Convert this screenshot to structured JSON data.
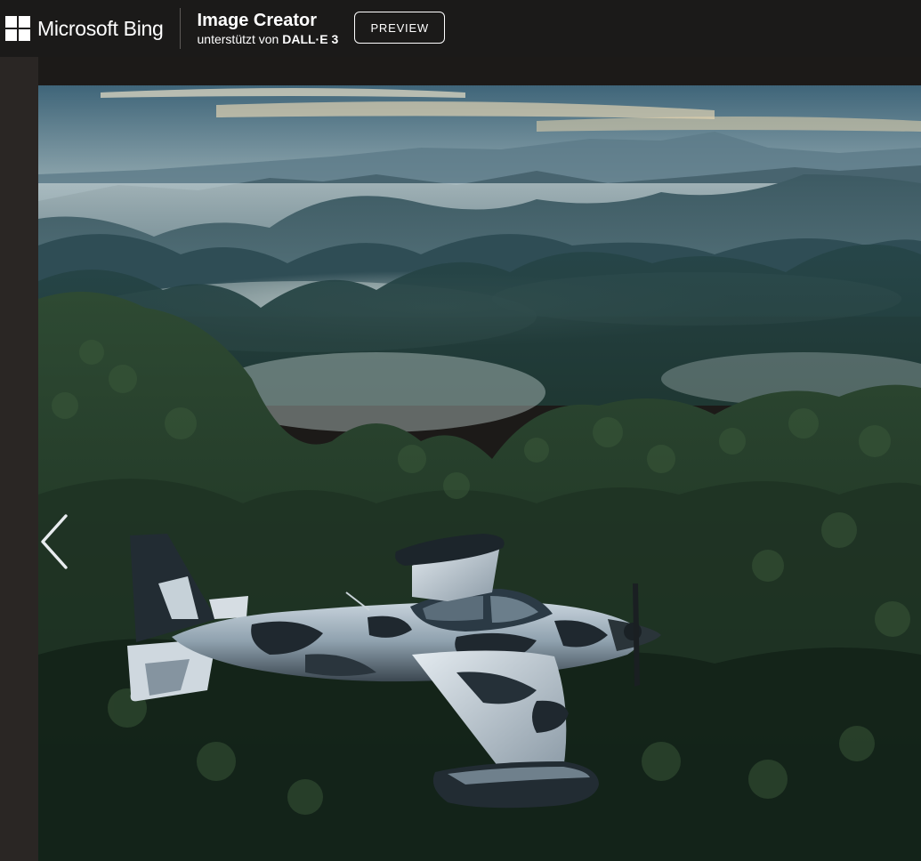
{
  "header": {
    "brand_name": "Microsoft Bing",
    "product_title": "Image Creator",
    "product_sub_prefix": "unterstützt von ",
    "product_sub_strong": "DALL·E 3",
    "preview_label": "PREVIEW"
  },
  "icons": {
    "brand_logo": "microsoft-windows-logo-icon",
    "prev": "chevron-left-icon"
  },
  "colors": {
    "topbar_bg": "#1b1a19",
    "page_bg": "#1c1a18",
    "text": "#ffffff"
  }
}
